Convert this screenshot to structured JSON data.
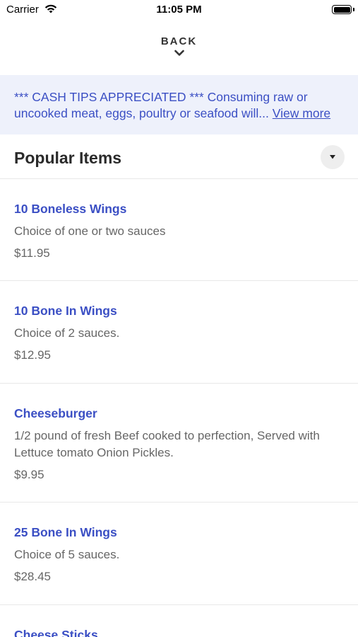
{
  "status_bar": {
    "carrier": "Carrier",
    "time": "11:05 PM"
  },
  "nav": {
    "back_label": "BACK"
  },
  "notice": {
    "text": "*** CASH TIPS APPRECIATED *** Consuming raw or uncooked meat, eggs, poultry or seafood will...",
    "link": "View more"
  },
  "section": {
    "title": "Popular Items"
  },
  "items": [
    {
      "name": "10 Boneless Wings",
      "description": "Choice of one or two sauces",
      "price": "$11.95"
    },
    {
      "name": "10 Bone In Wings",
      "description": "Choice of 2 sauces.",
      "price": "$12.95"
    },
    {
      "name": "Cheeseburger",
      "description": "1/2 pound of fresh Beef cooked to perfection, Served with Lettuce tomato Onion Pickles.",
      "price": "$9.95"
    },
    {
      "name": "25 Bone In Wings",
      "description": "Choice of 5 sauces.",
      "price": "$28.45"
    },
    {
      "name": "Cheese Sticks",
      "description": "",
      "price": ""
    }
  ],
  "colors": {
    "accent": "#3b4fc4",
    "notice_bg": "#eef1fb",
    "text_muted": "#666666"
  },
  "icons": {
    "wifi": "wifi-icon",
    "battery": "battery-icon",
    "back": "chevron-down-icon",
    "toggle": "caret-down-icon"
  }
}
